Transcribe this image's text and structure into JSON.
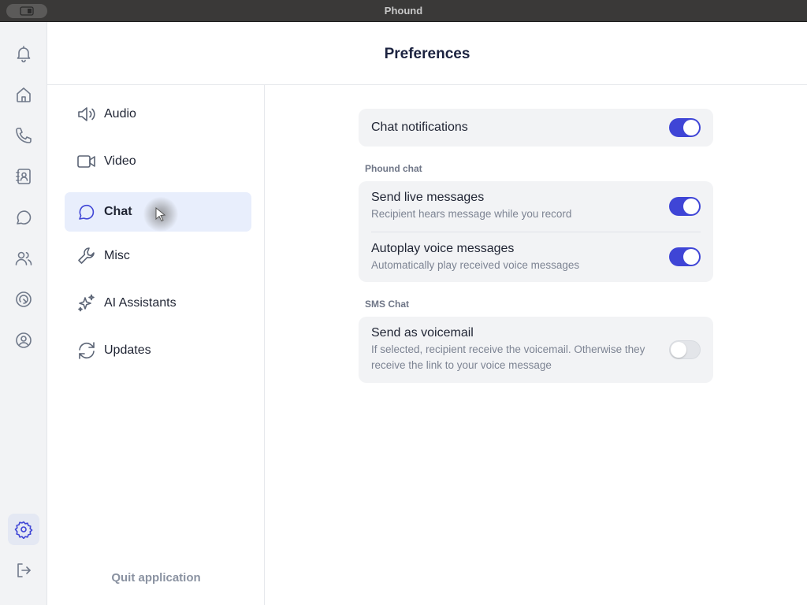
{
  "window": {
    "title": "Phound"
  },
  "rail": {
    "items": [
      {
        "icon": "bell-icon",
        "label": "notifications"
      },
      {
        "icon": "home-icon",
        "label": "home"
      },
      {
        "icon": "phone-icon",
        "label": "calls"
      },
      {
        "icon": "contacts-icon",
        "label": "contacts"
      },
      {
        "icon": "chat-icon",
        "label": "chat"
      },
      {
        "icon": "users-icon",
        "label": "people"
      },
      {
        "icon": "brand-icon",
        "label": "brand"
      },
      {
        "icon": "account-icon",
        "label": "account"
      },
      {
        "icon": "gear-icon",
        "label": "settings",
        "active": true
      },
      {
        "icon": "logout-icon",
        "label": "log out"
      }
    ]
  },
  "header": {
    "title": "Preferences"
  },
  "nav": {
    "items": [
      {
        "label": "Audio",
        "icon": "speaker-icon"
      },
      {
        "label": "Video",
        "icon": "video-icon"
      },
      {
        "label": "Chat",
        "icon": "chat-icon",
        "active": true
      },
      {
        "label": "Misc",
        "icon": "wrench-icon"
      },
      {
        "label": "AI Assistants",
        "icon": "sparkle-icon"
      },
      {
        "label": "Updates",
        "icon": "refresh-icon"
      }
    ],
    "quit_label": "Quit application"
  },
  "settings": {
    "chat_notifications": {
      "title": "Chat notifications",
      "enabled": true
    },
    "phound_chat": {
      "section_label": "Phound chat",
      "send_live": {
        "title": "Send live messages",
        "desc": "Recipient hears message while you record",
        "enabled": true
      },
      "autoplay": {
        "title": "Autoplay voice messages",
        "desc": "Automatically play received voice messages",
        "enabled": true
      }
    },
    "sms_chat": {
      "section_label": "SMS Chat",
      "send_voicemail": {
        "title": "Send as voicemail",
        "desc": "If selected, recipient receive the voicemail. Otherwise they receive the link to your voice message",
        "enabled": false
      }
    }
  },
  "colors": {
    "accent": "#3f45d6",
    "toggle_off": "#e3e5e9",
    "card_bg": "#f2f3f5",
    "active_nav_bg": "#e8eefc"
  }
}
